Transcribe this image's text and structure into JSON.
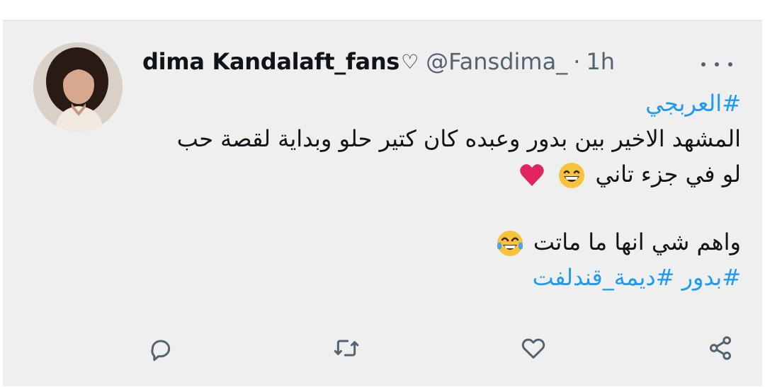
{
  "tweet": {
    "author": {
      "display_name": "dima Kandalaft_fans",
      "name_symbol": "♡",
      "handle": "@Fansdima_",
      "time_separator": "·",
      "time": "1h"
    },
    "lines": [
      "#العربجي",
      "المشهد الاخير بين بدور وعبده كان كتير حلو وبداية لقصة حب",
      "لو في جزء تاني",
      "واهم شي انها ما ماتت",
      "#بدور #ديمة_قندلفت"
    ],
    "hashtags": [
      "#العربجي",
      "#بدور",
      "#ديمة_قندلفت"
    ],
    "emojis": [
      "grinning-face",
      "red-heart",
      "face-with-tears-of-joy"
    ]
  },
  "actions": [
    "reply-icon",
    "retweet-icon",
    "like-icon",
    "share-icon"
  ],
  "colors": {
    "background": "#efefef",
    "text": "#0f1419",
    "muted": "#536471",
    "hashtag": "#1d9bf0",
    "heart": "#e0245e",
    "emoji_yellow": "#f7c23c"
  }
}
